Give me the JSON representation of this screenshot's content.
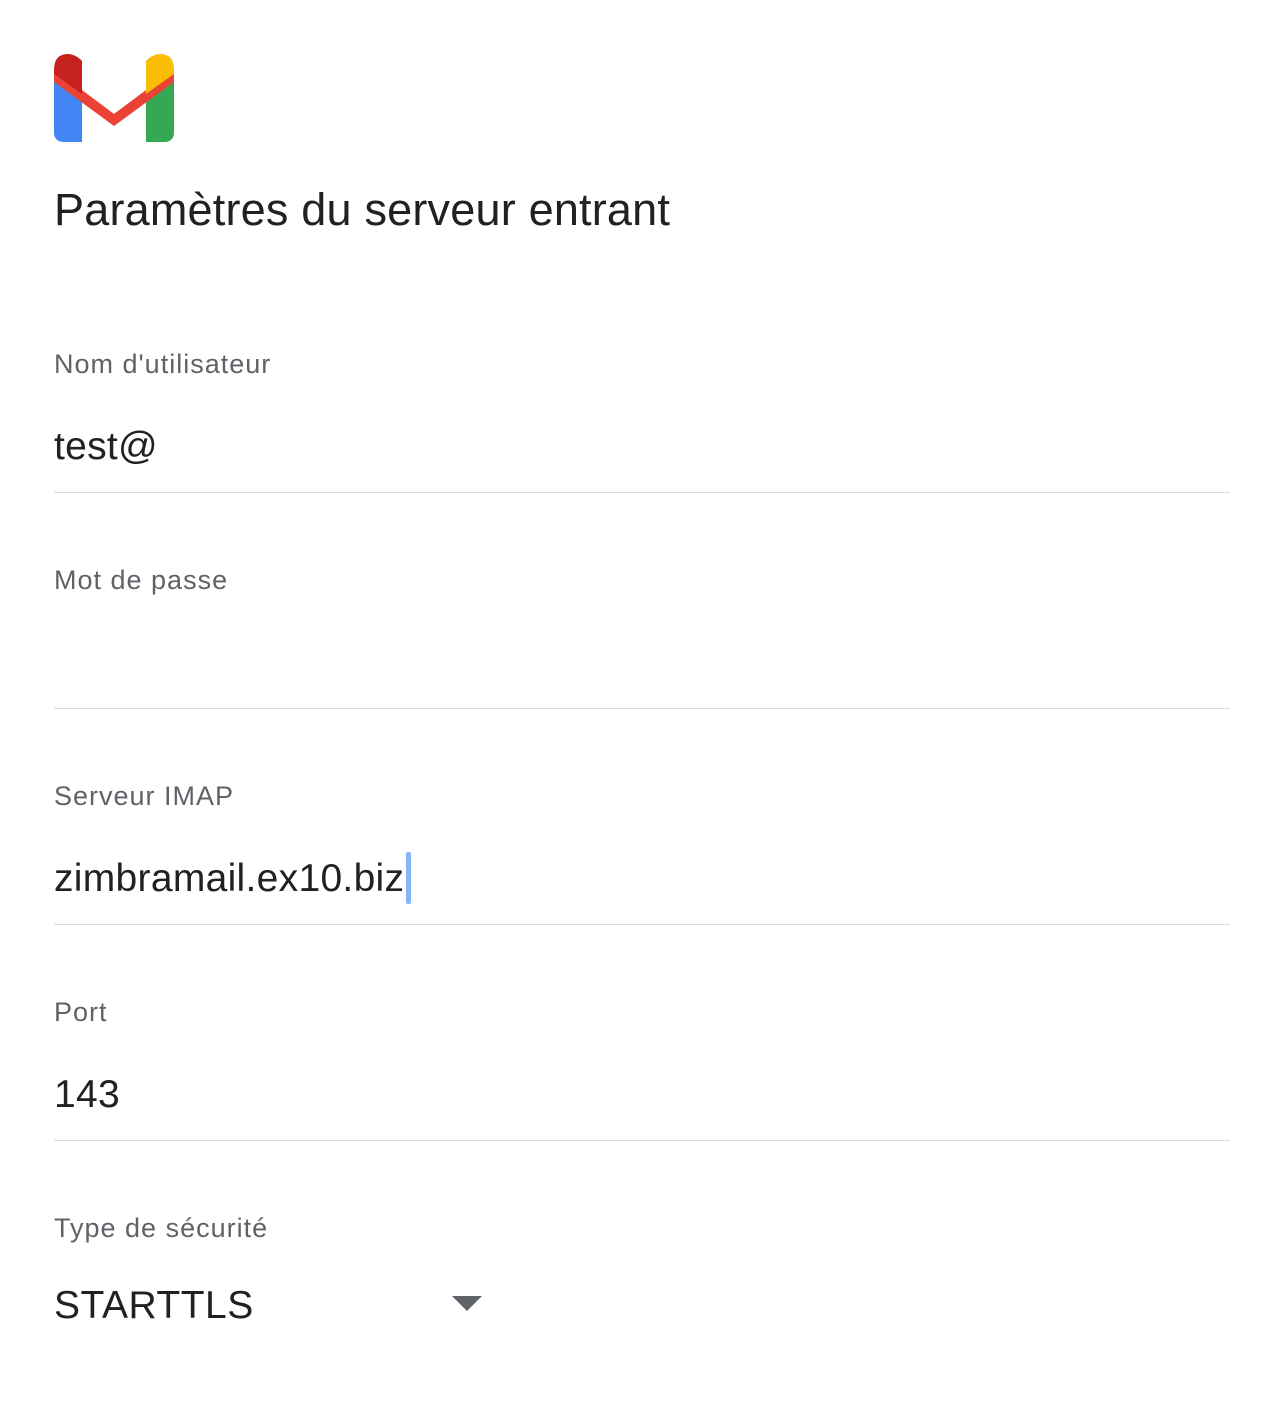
{
  "app": {
    "logo_icon": "gmail-logo-icon",
    "brand_colors": {
      "red": "#ea4335",
      "dark_red": "#c5221f",
      "blue": "#4285f4",
      "green": "#34a853",
      "yellow": "#fbbc04"
    }
  },
  "header": {
    "title": "Paramètres du serveur entrant"
  },
  "form": {
    "username": {
      "label": "Nom d'utilisateur",
      "value": "test@"
    },
    "password": {
      "label": "Mot de passe",
      "value": ""
    },
    "imap_server": {
      "label": "Serveur IMAP",
      "value": "zimbramail.ex10.biz"
    },
    "port": {
      "label": "Port",
      "value": "143"
    },
    "security_type": {
      "label": "Type de sécurité",
      "selected": "STARTTLS",
      "arrow_icon": "dropdown-arrow-icon"
    }
  },
  "colors": {
    "label": "#5f6368",
    "text": "#202124",
    "divider": "#dadce0",
    "caret": "#8ab4f8"
  }
}
